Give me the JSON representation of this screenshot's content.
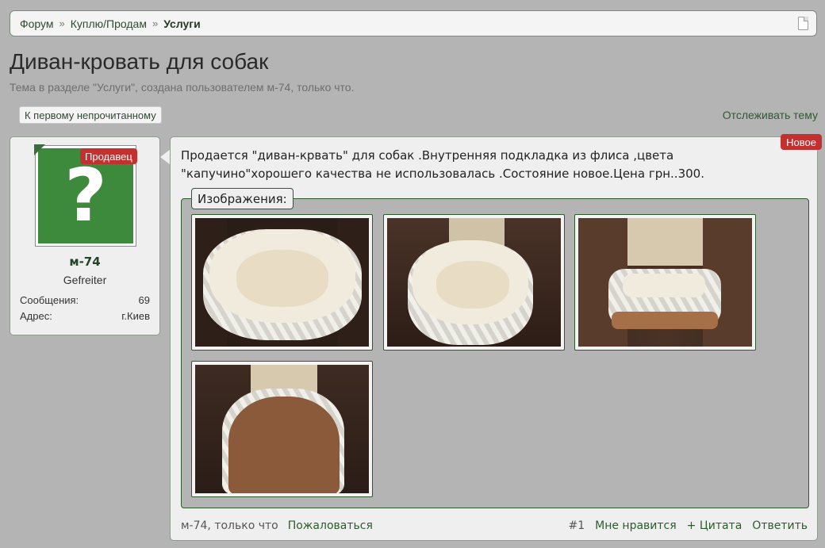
{
  "breadcrumb": {
    "items": [
      "Форум",
      "Куплю/Продам",
      "Услуги"
    ],
    "separator": "»"
  },
  "thread": {
    "title": "Диван-кровать для собак",
    "description": "Тема в разделе \"Услуги\", создана пользователем м-74, только что."
  },
  "actions": {
    "first_unread": "К первому непрочитанному",
    "watch": "Отслеживать тему"
  },
  "user": {
    "badge": "Продавец",
    "name": "м-74",
    "title": "Gefreiter",
    "stats": [
      {
        "label": "Сообщения:",
        "value": "69"
      },
      {
        "label": "Адрес:",
        "value": "г.Киев"
      }
    ],
    "avatar_icon": "question-mark-avatar"
  },
  "post": {
    "new_badge": "Новое",
    "text": "Продается \"диван-крвать\" для собак .Внутренняя подкладка из флиса ,цвета \"капучино\"хорошего качества не использовалась .Состояние новое.Цена грн..300.",
    "attachments_label": "Изображения:",
    "footer": {
      "author_time": "м-74, только что",
      "report": "Пожаловаться",
      "number": "#1",
      "like": "Мне нравится",
      "quote": "+ Цитата",
      "reply": "Ответить"
    }
  },
  "colors": {
    "accent_green": "#2f5a2f",
    "badge_red": "#c23030",
    "background": "#b4b4b4"
  }
}
